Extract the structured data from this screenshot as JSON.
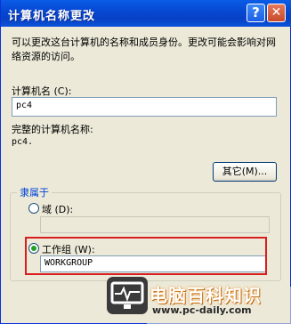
{
  "window": {
    "title": "计算机名称更改",
    "help_label": "?",
    "close_label": "✕"
  },
  "description": "可以更改这台计算机的名称和成员身份。更改可能会影响对网络资源的访问。",
  "computer_name": {
    "label": "计算机名 (C):",
    "value": "pc4"
  },
  "full_name": {
    "label": "完整的计算机名称:",
    "value": "pc4."
  },
  "other_button": "其它(M)...",
  "member_of": {
    "legend": "隶属于",
    "domain": {
      "label": "域 (D):",
      "checked": false,
      "value": ""
    },
    "workgroup": {
      "label": "工作组 (W):",
      "checked": true,
      "value": "WORKGROUP"
    }
  },
  "watermark": {
    "name": "电脑百科知识",
    "url": "www.pc-daily.com"
  },
  "colors": {
    "titlebar": "#0749d3",
    "highlight": "#d81e1e",
    "group_legend": "#0046d5"
  }
}
